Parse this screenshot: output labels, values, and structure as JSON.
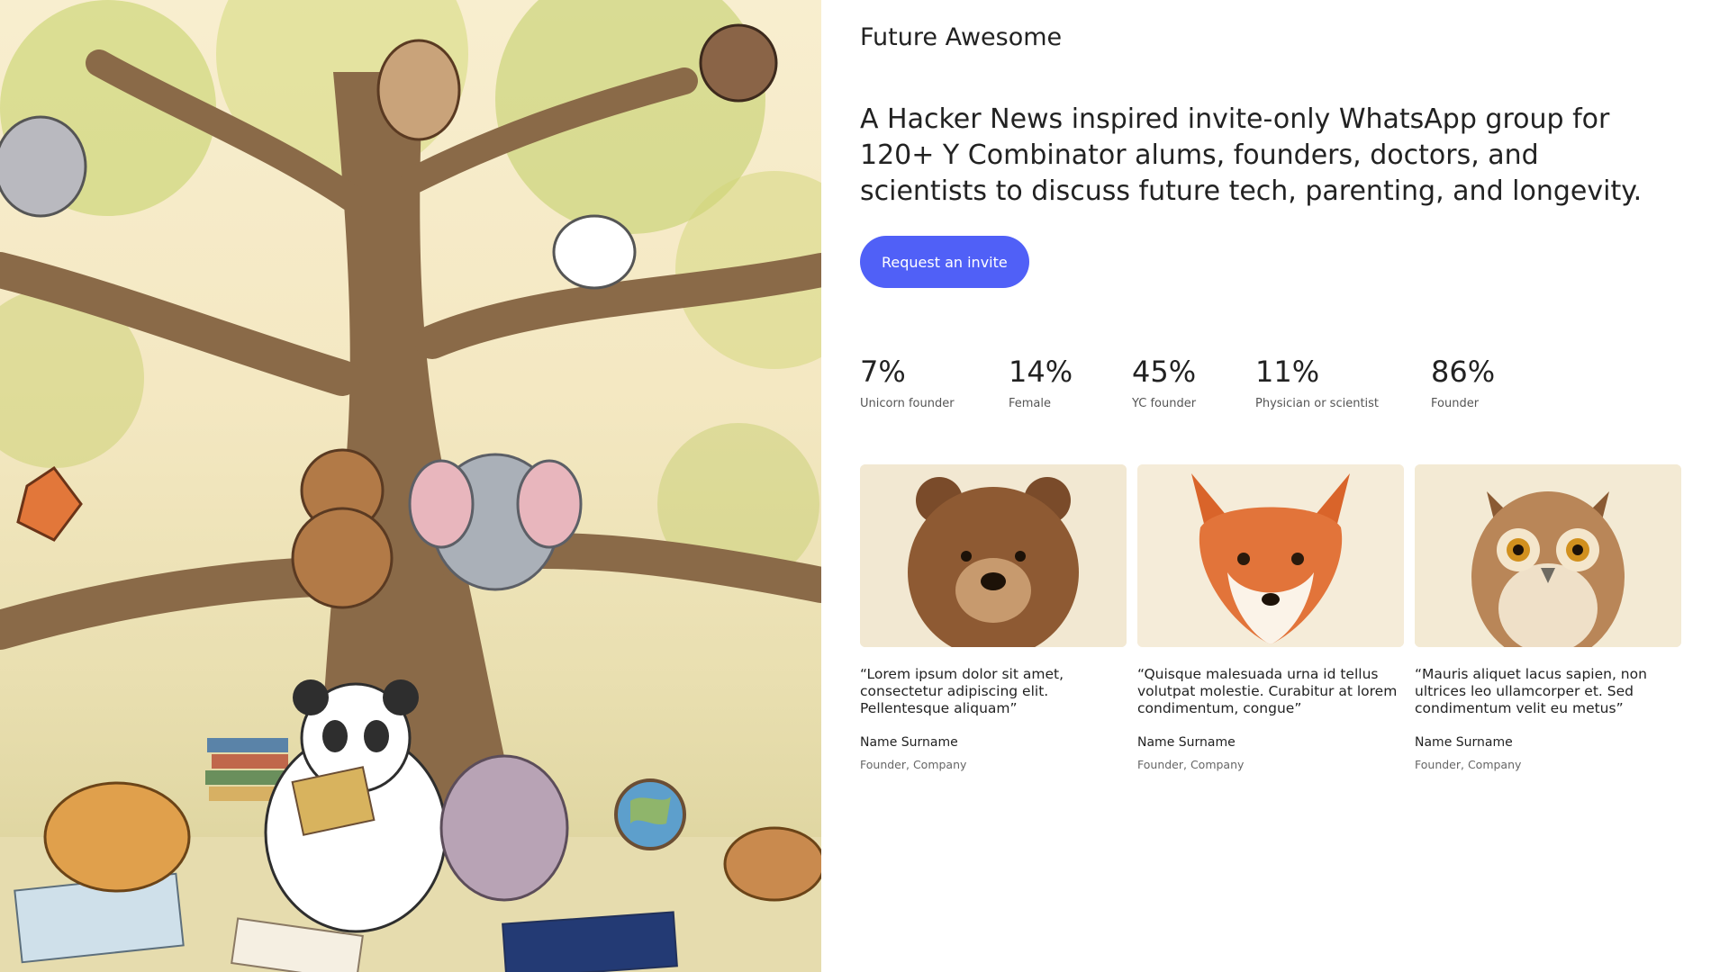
{
  "brand": {
    "name": "Future Awesome"
  },
  "hero": {
    "tagline": "A Hacker News inspired invite-only WhatsApp group for 120+ Y Combinator alums, founders, doctors, and scientists to discuss future tech, parenting, and longevity.",
    "cta_label": "Request an invite",
    "accent_color": "#5060f7",
    "illustration": "tree-of-reading-animals"
  },
  "stats": [
    {
      "value": "7%",
      "label": "Unicorn founder"
    },
    {
      "value": "14%",
      "label": "Female"
    },
    {
      "value": "45%",
      "label": "YC founder"
    },
    {
      "value": "11%",
      "label": "Physician or scientist"
    },
    {
      "value": "86%",
      "label": "Founder"
    }
  ],
  "testimonials": [
    {
      "animal": "bear",
      "quote": "“Lorem ipsum dolor sit amet, consectetur adipiscing elit. Pellentesque aliquam”",
      "name": "Name Surname",
      "role": "Founder, Company"
    },
    {
      "animal": "fox",
      "quote": "“Quisque malesuada urna id tellus volutpat molestie. Curabitur at lorem condimentum, congue”",
      "name": "Name Surname",
      "role": "Founder, Company"
    },
    {
      "animal": "owl",
      "quote": "“Mauris aliquet lacus sapien, non ultrices leo ullamcorper et. Sed condimentum velit eu metus”",
      "name": "Name Surname",
      "role": "Founder, Company"
    }
  ]
}
